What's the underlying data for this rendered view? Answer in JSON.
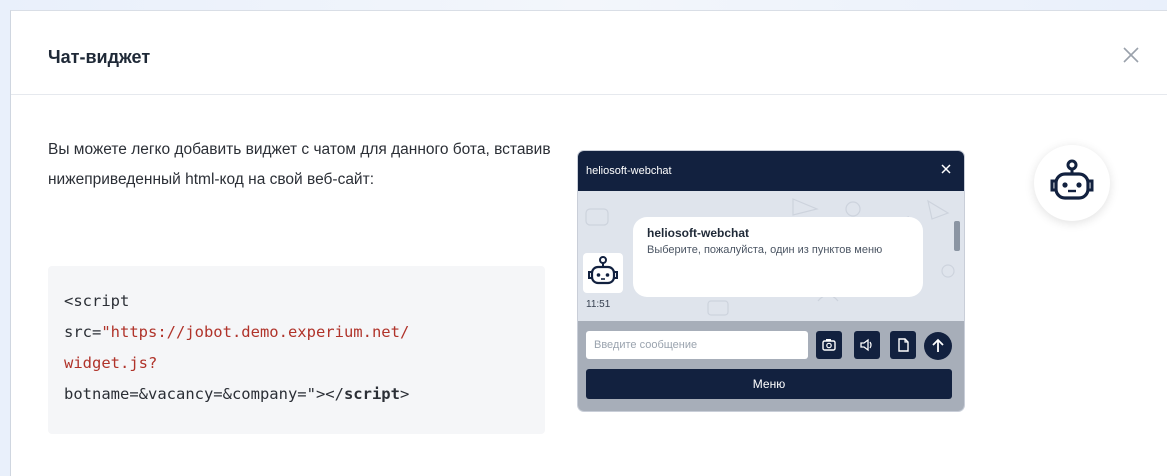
{
  "modal": {
    "title": "Чат-виджет",
    "close_icon": "close-icon"
  },
  "description": "Вы можете легко добавить виджет с чатом для данного бота, вставив нижеприведенный html-код на свой веб-сайт:",
  "code": {
    "line1": "<script",
    "line2_attr": "src=",
    "line2_str": "\"https://jobot.demo.experium.net/",
    "line3_str": "widget.js?",
    "line4_str": "botname=&vacancy=&company=\"",
    "line4_close": "></",
    "line4_kw": "script",
    "line4_end": ">"
  },
  "webchat": {
    "header_title": "heliosoft-webchat",
    "close_icon": "close-icon",
    "bubble_name": "heliosoft-webchat",
    "bubble_text": "Выберите, пожалуйста, один из пунктов меню",
    "time": "11:51",
    "input_placeholder": "Введите сообщение",
    "menu_label": "Меню",
    "colors": {
      "header": "#12213f",
      "footer": "#a7aeb9"
    }
  },
  "bot_avatar_icon": "robot-icon"
}
